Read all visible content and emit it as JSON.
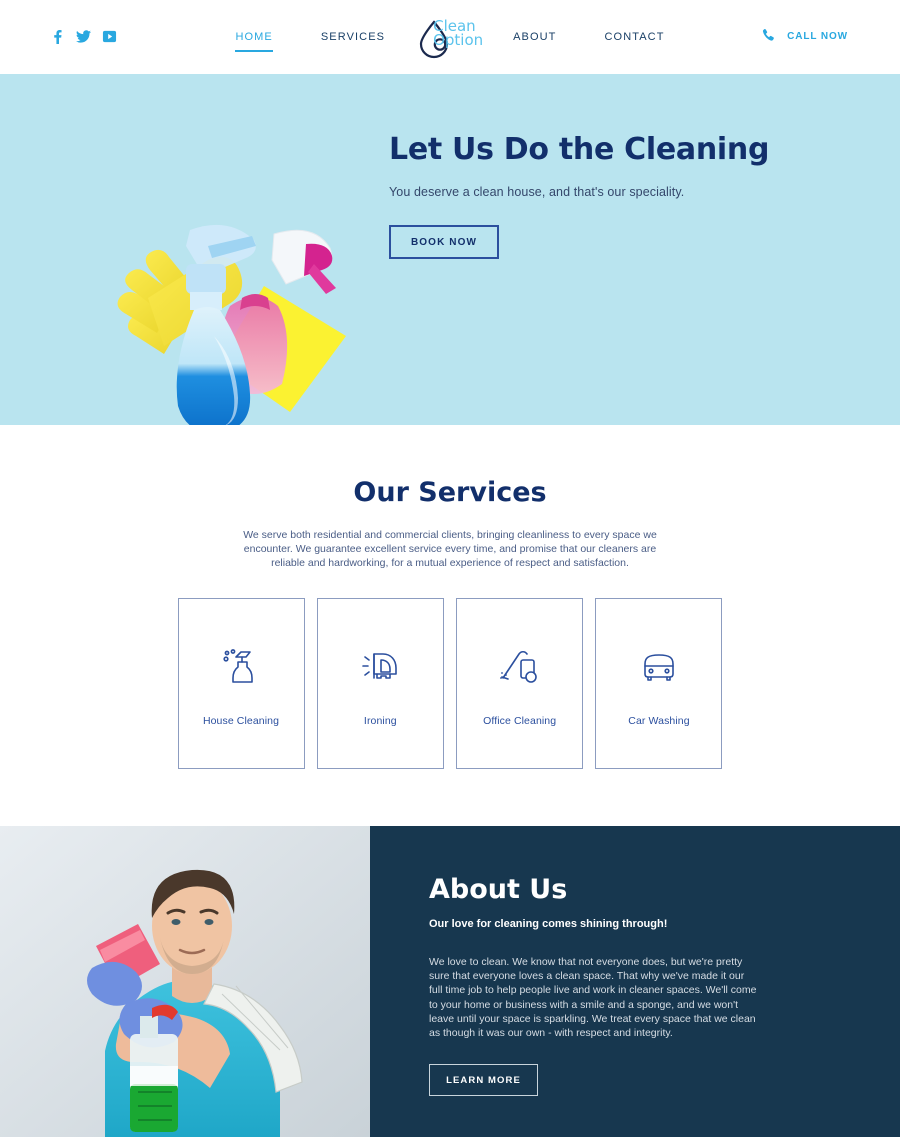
{
  "header": {
    "social": [
      {
        "name": "facebook-icon",
        "label": "Facebook"
      },
      {
        "name": "twitter-icon",
        "label": "Twitter"
      },
      {
        "name": "youtube-icon",
        "label": "YouTube"
      }
    ],
    "nav_left": [
      {
        "label": "HOME",
        "active": true
      },
      {
        "label": "SERVICES",
        "active": false
      }
    ],
    "nav_right": [
      {
        "label": "ABOUT",
        "active": false
      },
      {
        "label": "CONTACT",
        "active": false
      }
    ],
    "logo": {
      "line1": "Clean",
      "line2": "Option",
      "icon": "water-droplet-icon"
    },
    "call": {
      "label": "CALL NOW",
      "icon": "phone-icon"
    }
  },
  "hero": {
    "title": "Let Us Do the Cleaning",
    "subtitle": "You deserve a clean house, and that's our speciality.",
    "cta": "BOOK NOW",
    "image_alt": "cleaning-supplies-photo"
  },
  "services": {
    "title": "Our Services",
    "description": "We serve both residential and commercial clients, bringing cleanliness to every space we encounter. We guarantee excellent service every time, and promise that our cleaners are reliable and hardworking, for a mutual experience of respect and satisfaction.",
    "cards": [
      {
        "label": "House Cleaning",
        "icon": "spray-bottle-icon"
      },
      {
        "label": "Ironing",
        "icon": "clothes-iron-icon"
      },
      {
        "label": "Office Cleaning",
        "icon": "vacuum-cleaner-icon"
      },
      {
        "label": "Car Washing",
        "icon": "car-front-icon"
      }
    ]
  },
  "about": {
    "title": "About Us",
    "tagline": "Our love for cleaning comes shining through!",
    "body": "We love to clean. We know that not everyone does, but we're pretty sure that everyone loves a clean space.  That why we've made it our full time job to help people live and work in cleaner spaces. We'll come to your home or business with a smile and a sponge, and we won't leave until your space is sparkling. We treat every space that we clean as though it was our own - with respect and integrity.",
    "cta": "LEARN MORE",
    "image_alt": "cleaner-man-photo"
  },
  "colors": {
    "accent_blue": "#29a8e0",
    "navy": "#122f6b",
    "hero_bg": "#b9e4ef",
    "about_bg": "#17374f",
    "card_border": "#8c9cc0"
  }
}
